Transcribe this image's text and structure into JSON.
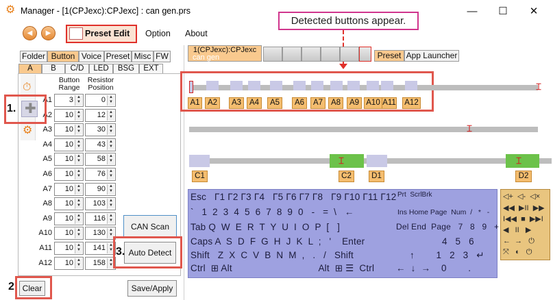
{
  "window": {
    "title": "Manager - [1(CPJexc):CPJexc] : can gen.prs",
    "minimize": "—",
    "maximize": "☐",
    "close": "✕"
  },
  "callout": {
    "text": "Detected buttons appear."
  },
  "toolbar": {
    "back": "◀",
    "forward": "▶",
    "preset_edit": "Preset Edit",
    "menus": [
      "Option",
      "About"
    ]
  },
  "left_tabs": [
    "Folder",
    "Button",
    "Voice",
    "Preset",
    "Misc",
    "FW"
  ],
  "left_tabs_active": "Button",
  "sub_tabs": [
    "A",
    "B",
    "C/D",
    "LED",
    "BSG",
    "EXT"
  ],
  "sub_tabs_active": "A",
  "table": {
    "header_range": "Button\nRange",
    "header_resistor": "Resistor\nPosition",
    "rows": [
      {
        "label": "A1",
        "range": "3",
        "position": "0"
      },
      {
        "label": "A2",
        "range": "10",
        "position": "12"
      },
      {
        "label": "A3",
        "range": "10",
        "position": "30"
      },
      {
        "label": "A4",
        "range": "10",
        "position": "43"
      },
      {
        "label": "A5",
        "range": "10",
        "position": "58"
      },
      {
        "label": "A6",
        "range": "10",
        "position": "76"
      },
      {
        "label": "A7",
        "range": "10",
        "position": "90"
      },
      {
        "label": "A8",
        "range": "10",
        "position": "103"
      },
      {
        "label": "A9",
        "range": "10",
        "position": "116"
      },
      {
        "label": "A10",
        "range": "10",
        "position": "130"
      },
      {
        "label": "A11",
        "range": "10",
        "position": "141"
      },
      {
        "label": "A12",
        "range": "10",
        "position": "158"
      }
    ]
  },
  "buttons": {
    "can_scan": "CAN Scan",
    "auto_detect": "Auto Detect",
    "clear": "Clear",
    "save_apply": "Save/Apply"
  },
  "steps": {
    "one": "1.",
    "two": "2",
    "three": "3."
  },
  "right_tabs": {
    "device_line1": "1(CPJexc):CPJexc",
    "device_line2": "can gen",
    "preset": "Preset",
    "app_launcher": "App Launcher"
  },
  "detected_labels": [
    "A1",
    "A2",
    "A3",
    "A4",
    "A5",
    "A6",
    "A7",
    "A8",
    "A9",
    "A10",
    "A11",
    "A12"
  ],
  "can_labels": [
    "C1",
    "C2",
    "D1",
    "D2"
  ],
  "keyboard": {
    "row1": "Esc   Γ1 Γ2 Γ3 Γ4   Γ5 Γ6 Γ7 Γ8   Γ9 Γ10 Γ11 Γ12",
    "row1_right": "Prt  ScrlBrk",
    "row2": "`   1  2  3  4  5  6  7  8  9  0   -   =  \\   ←",
    "row2_right": "Ins Home Page  Num  /   *   -",
    "row3": "Tab Q  W  E  R  T  Y  U  I  O  P  [   ]",
    "row3_right": "Del End  Page   7   8   9   +",
    "row4": "Caps A  S  D  F  G  H  J  K  L  ;   '    Enter",
    "row4_right": "4   5   6",
    "row5": "Shift   Z  X  C  V  B  N  M  ,   .   /   Shift",
    "row5_right": "↑        1   2   3   ↵",
    "row6": "Ctrl  ⊞ Alt                                Alt  ⊞ ☰  Ctrl",
    "row6_right": "←  ↓  →    0        ."
  },
  "media": {
    "row1": "◁+  ◁-  ◁×",
    "row2": "◀◀  ▶II  ▶▶",
    "row3": "I◀◀  ■  ▶▶I",
    "row4": "◀   II   ▶",
    "row5": "←  →   ⏻",
    "row6": "⤧   ◐   ⏻"
  },
  "colors": {
    "accent_orange": "#f9c98e",
    "callout_border": "#d0358d",
    "highlight_red": "#e0302a",
    "label_fill": "#f4bd6f",
    "green_range": "#6cc24a",
    "keyboard_bg": "#9ea1e0",
    "media_bg": "#e9c57f"
  }
}
